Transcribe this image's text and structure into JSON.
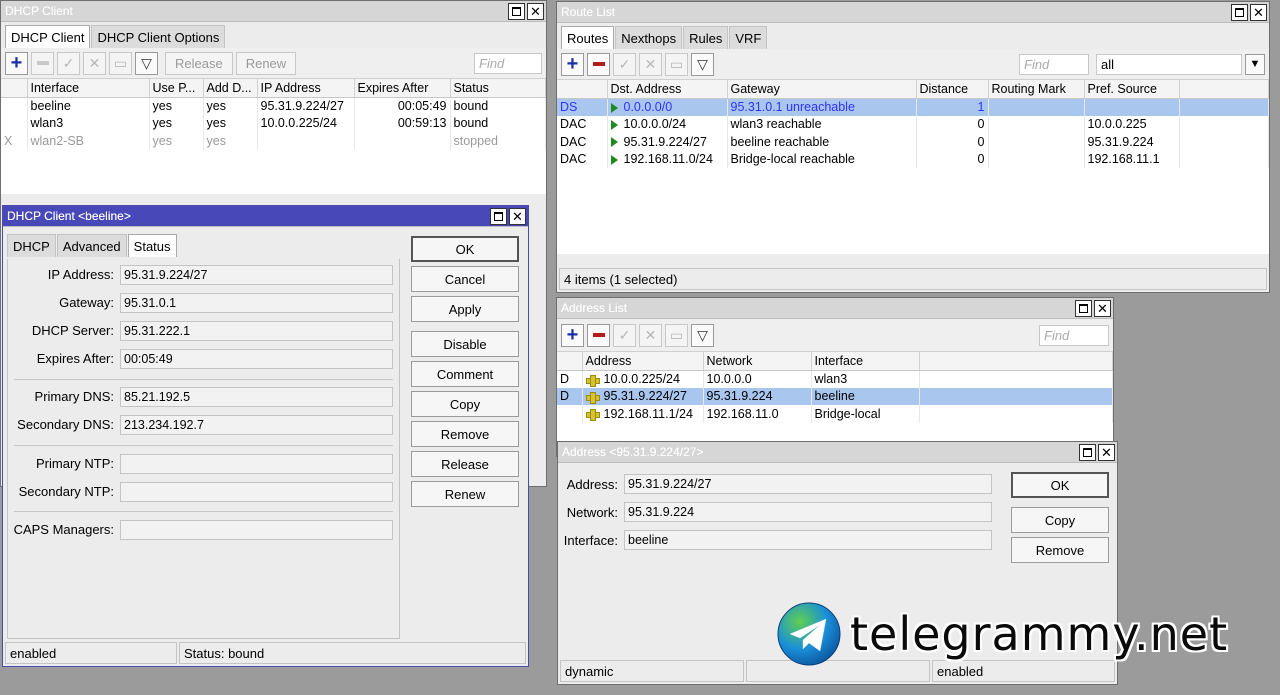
{
  "dhcp_client": {
    "title": "DHCP Client",
    "tabs": [
      "DHCP Client",
      "DHCP Client Options"
    ],
    "toolbar": {
      "release": "Release",
      "renew": "Renew",
      "find_placeholder": "Find"
    },
    "columns": [
      "Interface",
      "Use P...",
      "Add D...",
      "IP Address",
      "Expires After",
      "Status"
    ],
    "rows": [
      {
        "flag": "",
        "interface": "beeline",
        "use_peer": "yes",
        "add_default": "yes",
        "ip": "95.31.9.224/27",
        "expires": "00:05:49",
        "status": "bound"
      },
      {
        "flag": "",
        "interface": "wlan3",
        "use_peer": "yes",
        "add_default": "yes",
        "ip": "10.0.0.225/24",
        "expires": "00:59:13",
        "status": "bound"
      },
      {
        "flag": "X",
        "interface": "wlan2-SB",
        "use_peer": "yes",
        "add_default": "yes",
        "ip": "",
        "expires": "",
        "status": "stopped"
      }
    ]
  },
  "dhcp_detail": {
    "title": "DHCP Client <beeline>",
    "tabs": [
      "DHCP",
      "Advanced",
      "Status"
    ],
    "fields": {
      "ip_label": "IP Address:",
      "ip": "95.31.9.224/27",
      "gw_label": "Gateway:",
      "gw": "95.31.0.1",
      "srv_label": "DHCP Server:",
      "srv": "95.31.222.1",
      "exp_label": "Expires After:",
      "exp": "00:05:49",
      "pdns_label": "Primary DNS:",
      "pdns": "85.21.192.5",
      "sdns_label": "Secondary DNS:",
      "sdns": "213.234.192.7",
      "pntp_label": "Primary NTP:",
      "pntp": "",
      "sntp_label": "Secondary NTP:",
      "sntp": "",
      "caps_label": "CAPS Managers:",
      "caps": ""
    },
    "buttons": [
      "OK",
      "Cancel",
      "Apply",
      "Disable",
      "Comment",
      "Copy",
      "Remove",
      "Release",
      "Renew"
    ],
    "status": [
      "enabled",
      "Status: bound"
    ]
  },
  "route_list": {
    "title": "Route List",
    "tabs": [
      "Routes",
      "Nexthops",
      "Rules",
      "VRF"
    ],
    "find_placeholder": "Find",
    "filter_value": "all",
    "columns": [
      "Dst. Address",
      "Gateway",
      "Distance",
      "Routing Mark",
      "Pref. Source"
    ],
    "rows": [
      {
        "flag": "DS",
        "dst": "0.0.0.0/0",
        "gw": "95.31.0.1 unreachable",
        "dist": "1",
        "mark": "",
        "pref": ""
      },
      {
        "flag": "DAC",
        "dst": "10.0.0.0/24",
        "gw": "wlan3 reachable",
        "dist": "0",
        "mark": "",
        "pref": "10.0.0.225"
      },
      {
        "flag": "DAC",
        "dst": "95.31.9.224/27",
        "gw": "beeline reachable",
        "dist": "0",
        "mark": "",
        "pref": "95.31.9.224"
      },
      {
        "flag": "DAC",
        "dst": "192.168.11.0/24",
        "gw": "Bridge-local reachable",
        "dist": "0",
        "mark": "",
        "pref": "192.168.11.1"
      }
    ],
    "status": "4 items (1 selected)"
  },
  "address_list": {
    "title": "Address List",
    "find_placeholder": "Find",
    "columns": [
      "Address",
      "Network",
      "Interface"
    ],
    "rows": [
      {
        "flag": "D",
        "address": "10.0.0.225/24",
        "network": "10.0.0.0",
        "interface": "wlan3"
      },
      {
        "flag": "D",
        "address": "95.31.9.224/27",
        "network": "95.31.9.224",
        "interface": "beeline"
      },
      {
        "flag": "",
        "address": "192.168.11.1/24",
        "network": "192.168.11.0",
        "interface": "Bridge-local"
      }
    ]
  },
  "address_detail": {
    "title": "Address <95.31.9.224/27>",
    "addr_label": "Address:",
    "addr": "95.31.9.224/27",
    "net_label": "Network:",
    "net": "95.31.9.224",
    "if_label": "Interface:",
    "if": "beeline",
    "buttons": [
      "OK",
      "Copy",
      "Remove"
    ],
    "status": [
      "dynamic",
      "",
      "enabled"
    ]
  },
  "watermark": "telegrammy.net",
  "colors": {
    "selected_row": "#a9c7ee",
    "active_title": "#4848b8",
    "add_button": "#1a2fa6",
    "remove_button": "#b41c1c"
  }
}
